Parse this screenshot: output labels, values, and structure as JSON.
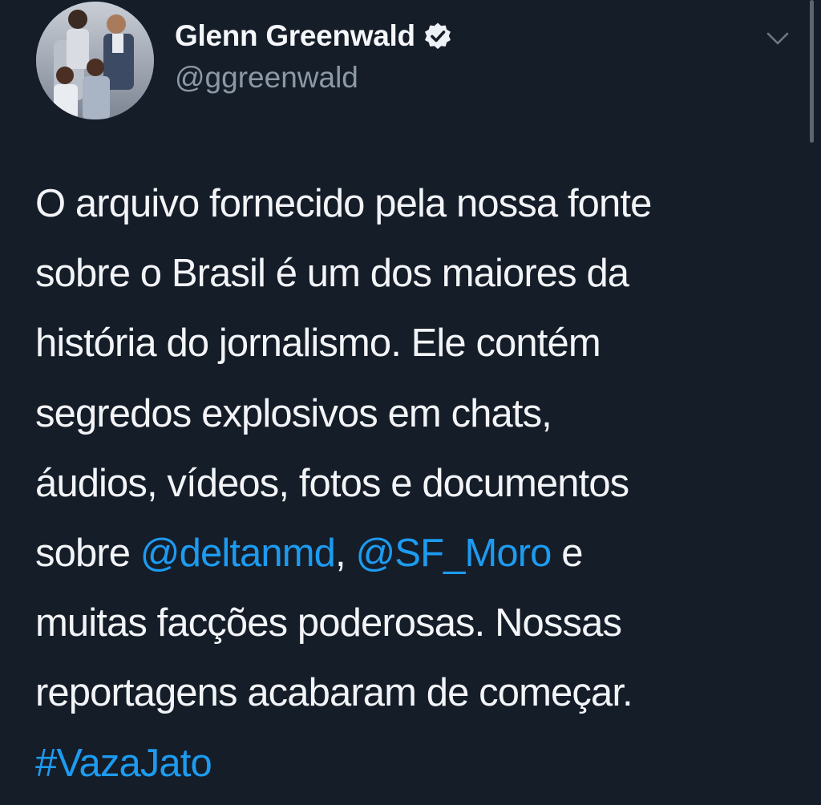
{
  "author": {
    "display_name": "Glenn Greenwald",
    "handle": "@ggreenwald",
    "verified": true
  },
  "icons": {
    "verified": "verified-badge-icon",
    "menu": "chevron-down-icon"
  },
  "colors": {
    "background": "#151d28",
    "text": "#f2f4f7",
    "secondary_text": "#8b98a5",
    "link": "#1d9bf0"
  },
  "tweet": {
    "line1": "O arquivo fornecido pela nossa fonte",
    "line2": "sobre o Brasil é um dos maiores da",
    "line3": "história do jornalismo. Ele contém",
    "line4": "segredos explosivos em chats,",
    "line5": "áudios, vídeos, fotos e documentos",
    "line6_prefix": "sobre ",
    "mention1": "@deltanmd",
    "line6_sep": ", ",
    "mention2": "@SF_Moro",
    "line6_suffix": " e",
    "line7": "muitas facções poderosas. Nossas",
    "line8": "reportagens acabaram de começar.",
    "hashtag": "#VazaJato"
  }
}
